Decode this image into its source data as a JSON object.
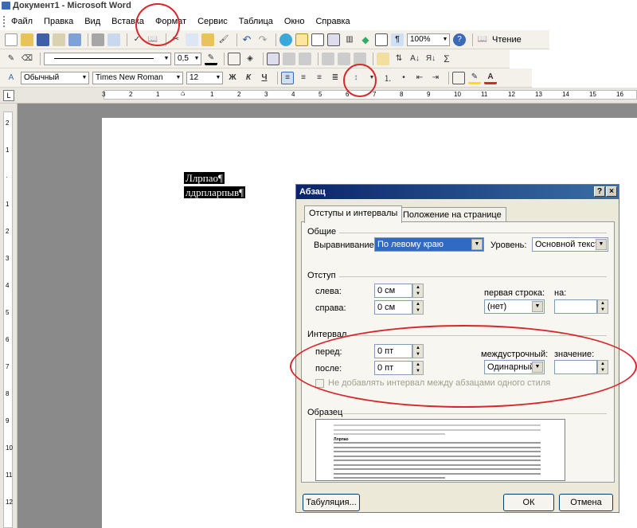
{
  "window": {
    "title": "Документ1 - Microsoft Word"
  },
  "menu": [
    "Файл",
    "Правка",
    "Вид",
    "Вставка",
    "Формат",
    "Сервис",
    "Таблица",
    "Окно",
    "Справка"
  ],
  "toolbar1": {
    "zoom": "100%",
    "reading_label": "Чтение"
  },
  "toolbar2": {
    "line_width": "0,5"
  },
  "toolbar3": {
    "style": "Обычный",
    "font": "Times New Roman",
    "size": "12",
    "bold": "Ж",
    "italic": "К",
    "underline": "Ч"
  },
  "ruler": {
    "marks": [
      "3",
      "2",
      "1",
      "",
      "1",
      "2",
      "3",
      "4",
      "5",
      "6",
      "7",
      "8",
      "9",
      "10",
      "11",
      "12",
      "13",
      "14",
      "15",
      "16"
    ]
  },
  "vruler": {
    "marks": [
      "2",
      "1",
      "",
      "1",
      "2",
      "3",
      "4",
      "5",
      "6",
      "7",
      "8",
      "9",
      "10",
      "11",
      "12"
    ]
  },
  "document": {
    "lines": [
      "Ллрпао¶",
      "лдрпларпыв¶"
    ]
  },
  "dialog": {
    "title": "Абзац",
    "help": "?",
    "close": "×",
    "tabs": [
      "Отступы и интервалы",
      "Положение на странице"
    ],
    "general": {
      "header": "Общие",
      "alignment_label": "Выравнивание:",
      "alignment_value": "По левому краю",
      "level_label": "Уровень:",
      "level_value": "Основной текст"
    },
    "indent": {
      "header": "Отступ",
      "left_label": "слева:",
      "left_value": "0 см",
      "right_label": "справа:",
      "right_value": "0 см",
      "first_line_label": "первая строка:",
      "first_line_value": "(нет)",
      "by_label": "на:",
      "by_value": ""
    },
    "spacing": {
      "header": "Интервал",
      "before_label": "перед:",
      "before_value": "0 пт",
      "after_label": "после:",
      "after_value": "0 пт",
      "line_label": "междустрочный:",
      "line_value": "Одинарный",
      "at_label": "значение:",
      "at_value": "",
      "no_space_label": "Не добавлять интервал между абзацами одного стиля"
    },
    "preview": {
      "header": "Образец",
      "sample_bold": "Ллрпао"
    },
    "buttons": {
      "tabs": "Табуляция...",
      "ok": "ОК",
      "cancel": "Отмена"
    }
  },
  "colors": {
    "annotation": "#d8262b",
    "dialog_title": "#0a246a",
    "dialog_bg": "#ece9d8"
  }
}
